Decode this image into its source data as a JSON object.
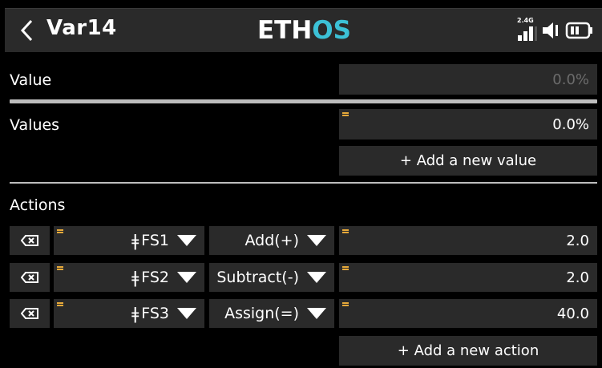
{
  "header": {
    "back_icon": "chevron-left-icon",
    "title": "Var14",
    "logo_primary": "ETH",
    "logo_accent": "OS",
    "brand_color": "#3cc1d6",
    "status_icons": [
      "signal-2.4g-icon",
      "volume-icon",
      "battery-icon"
    ],
    "band_label": "2.4G"
  },
  "value_row": {
    "label": "Value",
    "value": "0.0%"
  },
  "values_row": {
    "label": "Values",
    "value": "0.0%",
    "add_label": "+ Add a new value"
  },
  "actions": {
    "label": "Actions",
    "items": [
      {
        "source": "FS1",
        "operation": "Add(+)",
        "value": "2.0"
      },
      {
        "source": "FS2",
        "operation": "Subtract(-)",
        "value": "2.0"
      },
      {
        "source": "FS3",
        "operation": "Assign(=)",
        "value": "40.0"
      }
    ],
    "add_label": "+ Add a new action",
    "source_glyph": "ǂ"
  },
  "colors": {
    "background": "#000000",
    "field": "#2a2a2a",
    "marker": "#e6a93a",
    "divider": "#bdbdbd"
  }
}
